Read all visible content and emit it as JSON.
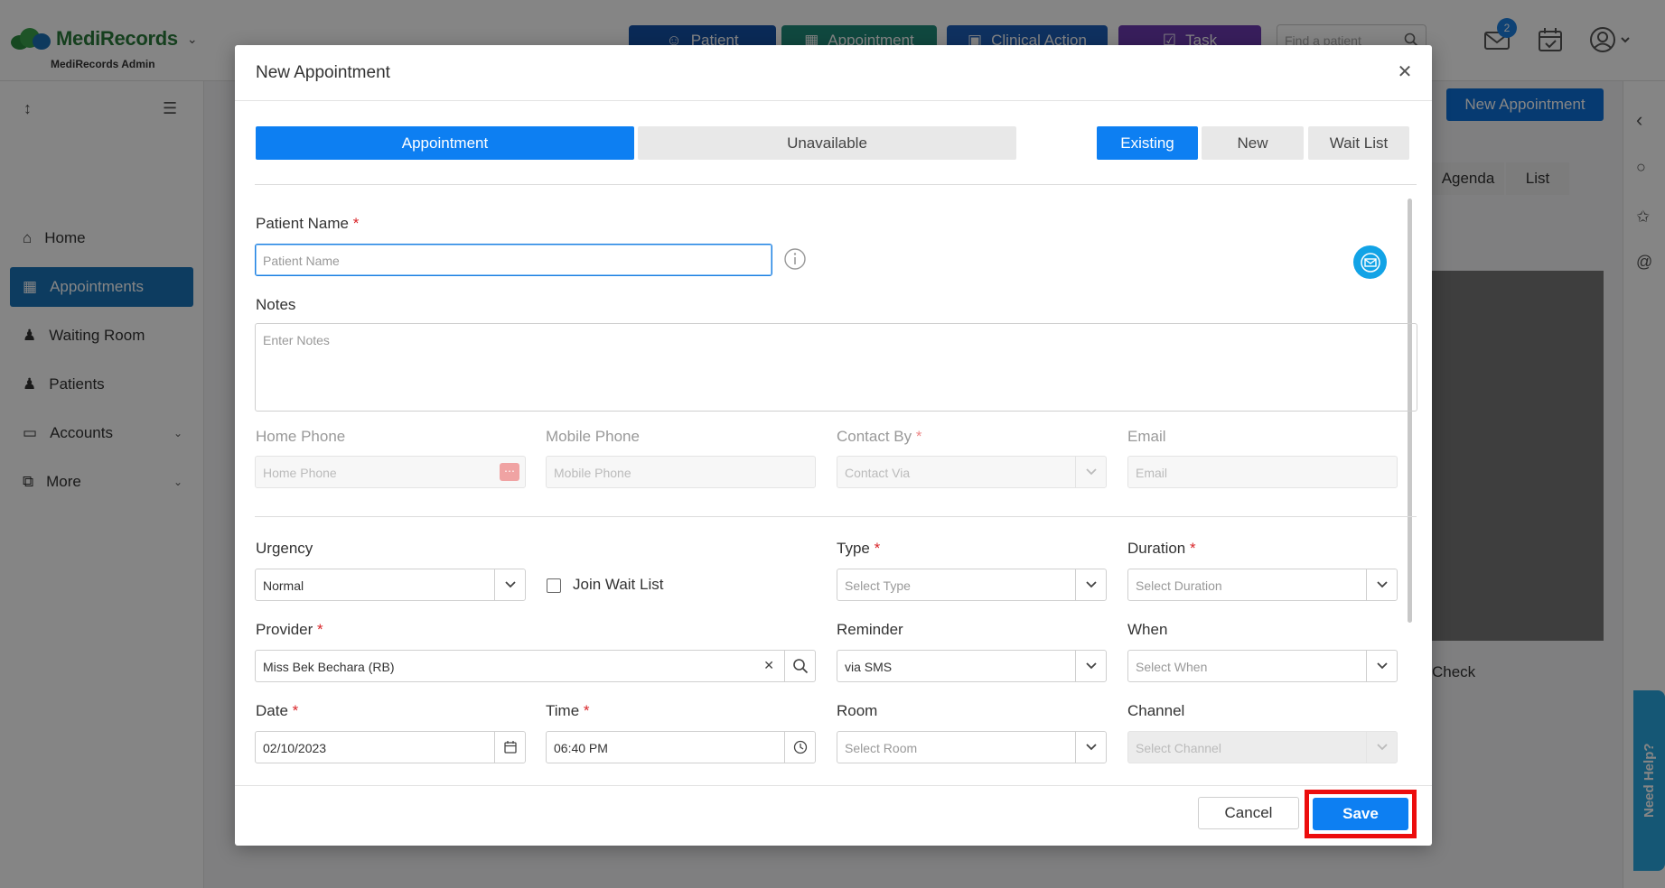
{
  "app": {
    "logo_text": "MediRecords",
    "org_name": "MediRecords Admin",
    "quick_actions": [
      {
        "label": "Patient",
        "color": "#1451a8"
      },
      {
        "label": "Appointment",
        "color": "#1f8a7a"
      },
      {
        "label": "Clinical Action",
        "color": "#1d5fb8"
      },
      {
        "label": "Task",
        "color": "#6c3bb0"
      }
    ],
    "search_placeholder": "Find a patient",
    "inbox_count": "2",
    "new_appointment_label": "New Appointment",
    "view_tabs": [
      "Agenda",
      "List"
    ],
    "check_label": "Check",
    "need_help": "Need Help?"
  },
  "sidebar": {
    "items": [
      {
        "label": "Home"
      },
      {
        "label": "Appointments"
      },
      {
        "label": "Waiting Room"
      },
      {
        "label": "Patients"
      },
      {
        "label": "Accounts"
      },
      {
        "label": "More"
      }
    ]
  },
  "modal": {
    "title": "New Appointment",
    "type_tabs": {
      "appointment": "Appointment",
      "unavailable": "Unavailable"
    },
    "patient_tabs": {
      "existing": "Existing",
      "new": "New",
      "wait_list": "Wait List"
    },
    "patient_name": {
      "label": "Patient Name",
      "placeholder": "Patient Name"
    },
    "notes": {
      "label": "Notes",
      "placeholder": "Enter Notes"
    },
    "home_phone": {
      "label": "Home Phone",
      "placeholder": "Home Phone"
    },
    "mobile_phone": {
      "label": "Mobile Phone",
      "placeholder": "Mobile Phone"
    },
    "contact_by": {
      "label": "Contact By",
      "placeholder": "Contact Via"
    },
    "email": {
      "label": "Email",
      "placeholder": "Email"
    },
    "urgency": {
      "label": "Urgency",
      "value": "Normal"
    },
    "join_wait_list": "Join Wait List",
    "type": {
      "label": "Type",
      "placeholder": "Select Type"
    },
    "duration": {
      "label": "Duration",
      "placeholder": "Select Duration"
    },
    "provider": {
      "label": "Provider",
      "value": "Miss Bek Bechara (RB)"
    },
    "reminder": {
      "label": "Reminder",
      "value": "via SMS"
    },
    "when": {
      "label": "When",
      "placeholder": "Select When"
    },
    "date": {
      "label": "Date",
      "value": "02/10/2023"
    },
    "time": {
      "label": "Time",
      "value": "06:40 PM"
    },
    "room": {
      "label": "Room",
      "placeholder": "Select Room"
    },
    "channel": {
      "label": "Channel",
      "placeholder": "Select Channel"
    },
    "required_mark": "*",
    "cancel_label": "Cancel",
    "save_label": "Save",
    "accent_color": "#0d7ff2",
    "highlight_color": "#ec0d0d"
  }
}
